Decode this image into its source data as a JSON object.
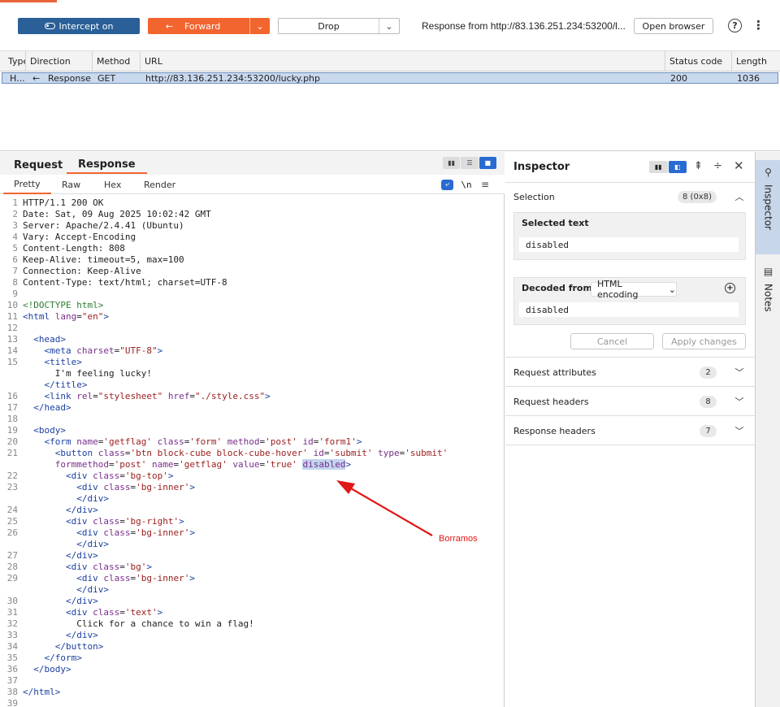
{
  "toolbar": {
    "intercept_label": "Intercept on",
    "forward_label": "Forward",
    "drop_label": "Drop",
    "response_from": "Response from http://83.136.251.234:53200/l...",
    "open_browser_label": "Open browser",
    "help_icon": "?",
    "more_icon": "⋮"
  },
  "history": {
    "columns": [
      "Type",
      "Direction",
      "Method",
      "URL",
      "Status code",
      "Length"
    ],
    "row": {
      "type": "H...",
      "direction_icon": "←",
      "direction": "Response",
      "method": "GET",
      "url": "http://83.136.251.234:53200/lucky.php",
      "status": "200",
      "length": "1036"
    }
  },
  "panel": {
    "tabs": [
      "Request",
      "Response"
    ],
    "active_tab": "Response",
    "subtabs": [
      "Pretty",
      "Raw",
      "Hex",
      "Render"
    ],
    "active_subtab": "Pretty",
    "newline_label": "\\n"
  },
  "code_lines": [
    {
      "n": "1",
      "html": "HTTP/1.1 200 OK"
    },
    {
      "n": "2",
      "html": "Date: Sat, 09 Aug 2025 10:02:42 GMT"
    },
    {
      "n": "3",
      "html": "Server: Apache/2.4.41 (Ubuntu)"
    },
    {
      "n": "4",
      "html": "Vary: Accept-Encoding"
    },
    {
      "n": "5",
      "html": "Content-Length: 808"
    },
    {
      "n": "6",
      "html": "Keep-Alive: timeout=5, max=100"
    },
    {
      "n": "7",
      "html": "Connection: Keep-Alive"
    },
    {
      "n": "8",
      "html": "Content-Type: text/html; charset=UTF-8"
    },
    {
      "n": "9",
      "html": ""
    },
    {
      "n": "10",
      "html": "<!DOCTYPE html>"
    },
    {
      "n": "11",
      "html": "<html lang=\"en\">"
    },
    {
      "n": "12",
      "html": ""
    },
    {
      "n": "13",
      "html": "  <head>"
    },
    {
      "n": "14",
      "html": "    <meta charset=\"UTF-8\">"
    },
    {
      "n": "15",
      "html": "    <title>"
    },
    {
      "n": "",
      "html": "      I'm feeling lucky!"
    },
    {
      "n": "",
      "html": "    </title>"
    },
    {
      "n": "16",
      "html": "    <link rel=\"stylesheet\" href=\"./style.css\">"
    },
    {
      "n": "17",
      "html": "  </head>"
    },
    {
      "n": "18",
      "html": ""
    },
    {
      "n": "19",
      "html": "  <body>"
    },
    {
      "n": "20",
      "html": "    <form name='getflag' class='form' method='post' id='form1'>"
    },
    {
      "n": "21",
      "html": "      <button class='btn block-cube block-cube-hover' id='submit' type='submit'"
    },
    {
      "n": "",
      "html": "      formmethod='post' name='getflag' value='true' disabled>"
    },
    {
      "n": "22",
      "html": "        <div class='bg-top'>"
    },
    {
      "n": "23",
      "html": "          <div class='bg-inner'>"
    },
    {
      "n": "",
      "html": "          </div>"
    },
    {
      "n": "24",
      "html": "        </div>"
    },
    {
      "n": "25",
      "html": "        <div class='bg-right'>"
    },
    {
      "n": "26",
      "html": "          <div class='bg-inner'>"
    },
    {
      "n": "",
      "html": "          </div>"
    },
    {
      "n": "27",
      "html": "        </div>"
    },
    {
      "n": "28",
      "html": "        <div class='bg'>"
    },
    {
      "n": "29",
      "html": "          <div class='bg-inner'>"
    },
    {
      "n": "",
      "html": "          </div>"
    },
    {
      "n": "30",
      "html": "        </div>"
    },
    {
      "n": "31",
      "html": "        <div class='text'>"
    },
    {
      "n": "32",
      "html": "          Click for a chance to win a flag!"
    },
    {
      "n": "33",
      "html": "        </div>"
    },
    {
      "n": "34",
      "html": "      </button>"
    },
    {
      "n": "35",
      "html": "    </form>"
    },
    {
      "n": "36",
      "html": "  </body>"
    },
    {
      "n": "37",
      "html": ""
    },
    {
      "n": "38",
      "html": "</html>"
    },
    {
      "n": "39",
      "html": ""
    }
  ],
  "annotation": {
    "label": "Borramos",
    "color": "#e01818"
  },
  "inspector": {
    "title": "Inspector",
    "selection_label": "Selection",
    "selection_badge": "8 (0x8)",
    "selected_text_title": "Selected text",
    "selected_text_value": "disabled",
    "decoded_from_label": "Decoded from:",
    "decoded_encoding": "HTML encoding",
    "decoded_value": "disabled",
    "cancel_label": "Cancel",
    "apply_label": "Apply changes",
    "sections": [
      {
        "label": "Request attributes",
        "count": "2"
      },
      {
        "label": "Request headers",
        "count": "8"
      },
      {
        "label": "Response headers",
        "count": "7"
      }
    ]
  },
  "rail": {
    "inspector_label": "Inspector",
    "notes_label": "Notes"
  },
  "colors": {
    "intercept": "#2a5f97",
    "forward": "#f3652f",
    "active_blue": "#2a6bd1",
    "selection_row": "#c9d9ee"
  }
}
